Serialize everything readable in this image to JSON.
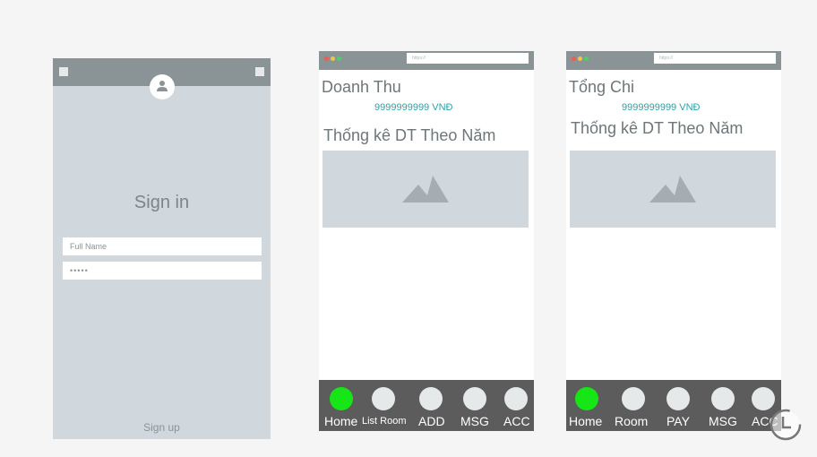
{
  "signin_screen": {
    "title": "Sign in",
    "name_placeholder": "Full Name",
    "password_mask": "•••••",
    "signup_link": "Sign up"
  },
  "browser_chrome": {
    "url_text": "https://"
  },
  "revenue_screen": {
    "heading": "Doanh Thu",
    "amount": "9999999999 VNĐ",
    "subheading": "Thống kê DT Theo Năm",
    "nav": [
      {
        "label": "Home",
        "active": true
      },
      {
        "label": "List Room",
        "active": false
      },
      {
        "label": "ADD",
        "active": false
      },
      {
        "label": "MSG",
        "active": false
      },
      {
        "label": "ACC",
        "active": false
      }
    ]
  },
  "expense_screen": {
    "heading": "Tổng Chi",
    "amount": "9999999999 VNĐ",
    "subheading": "Thống kê DT Theo Năm",
    "nav": [
      {
        "label": "Home",
        "active": true
      },
      {
        "label": "Room",
        "active": false
      },
      {
        "label": "PAY",
        "active": false
      },
      {
        "label": "MSG",
        "active": false
      },
      {
        "label": "ACC",
        "active": false
      }
    ]
  },
  "colors": {
    "active_nav": "#16e616",
    "accent_text": "#2aa3a9",
    "navbar_bg": "#5c5c5c"
  },
  "icons": [
    "user-icon",
    "image-placeholder-icon",
    "history-icon"
  ]
}
